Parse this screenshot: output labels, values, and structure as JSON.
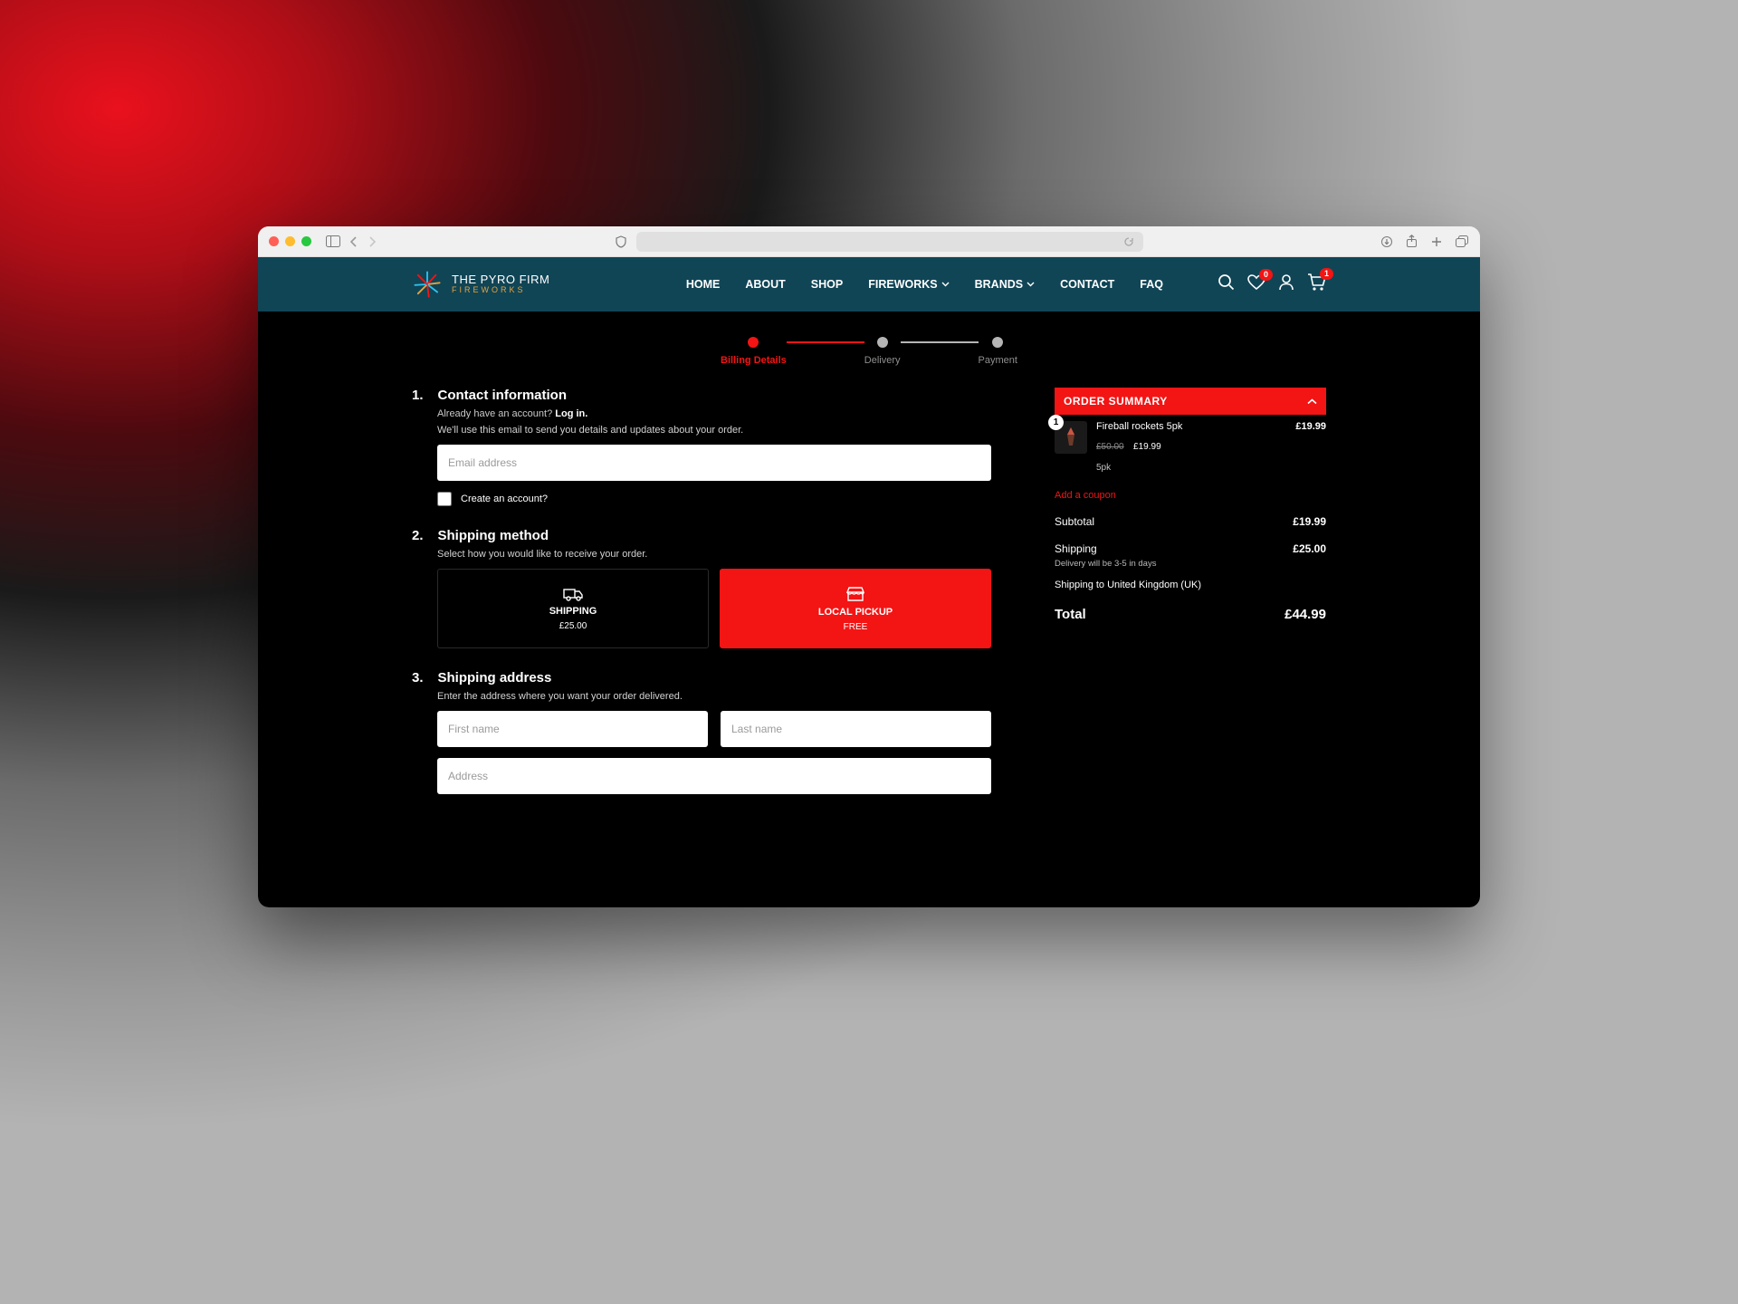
{
  "logo": {
    "line1": "THE PYRO FIRM",
    "line2": "FIREWORKS"
  },
  "nav": {
    "items": [
      "HOME",
      "ABOUT",
      "SHOP",
      "FIREWORKS",
      "BRANDS",
      "CONTACT",
      "FAQ"
    ],
    "wishlist_count": "0",
    "cart_count": "1"
  },
  "steps": {
    "s1": "Billing Details",
    "s2": "Delivery",
    "s3": "Payment"
  },
  "sec1": {
    "num": "1.",
    "title": "Contact information",
    "have_account": "Already have an account? ",
    "login": "Log in.",
    "desc": "We'll use this email to send you details and updates about your order.",
    "email_ph": "Email address",
    "create": "Create an account?"
  },
  "sec2": {
    "num": "2.",
    "title": "Shipping method",
    "desc": "Select how you would like to receive your order.",
    "optA": {
      "label": "SHIPPING",
      "price": "£25.00"
    },
    "optB": {
      "label": "LOCAL PICKUP",
      "price": "FREE"
    }
  },
  "sec3": {
    "num": "3.",
    "title": "Shipping address",
    "desc": "Enter the address where you want your order delivered.",
    "fn_ph": "First name",
    "ln_ph": "Last name",
    "addr_ph": "Address"
  },
  "summary": {
    "heading": "ORDER SUMMARY",
    "item": {
      "qty": "1",
      "name": "Fireball rockets 5pk",
      "price": "£19.99",
      "old": "£50.00",
      "new": "£19.99",
      "variant": "5pk"
    },
    "coupon": "Add a coupon",
    "subtotal_l": "Subtotal",
    "subtotal_v": "£19.99",
    "shipping_l": "Shipping",
    "shipping_v": "£25.00",
    "ship_note": "Delivery will be 3-5 in days",
    "ship_to": "Shipping to United Kingdom (UK)",
    "total_l": "Total",
    "total_v": "£44.99"
  }
}
